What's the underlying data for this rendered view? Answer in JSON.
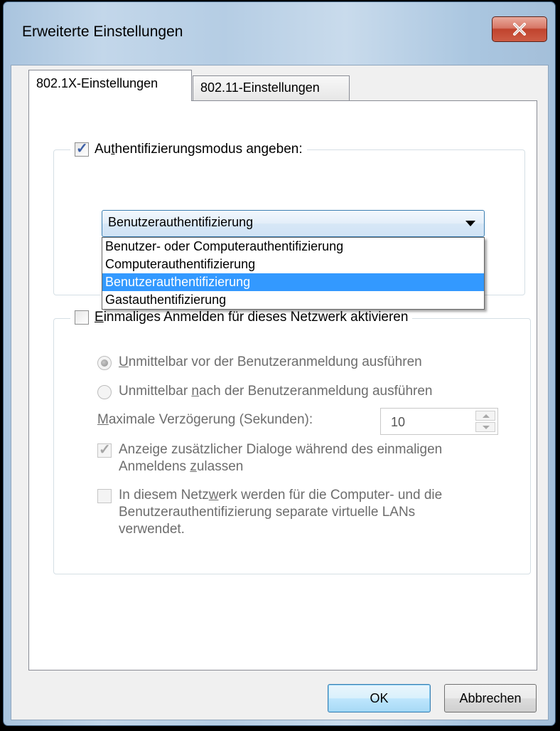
{
  "window": {
    "title": "Erweiterte Einstellungen",
    "close_label": "x"
  },
  "tabs": [
    {
      "label": "802.1X-Einstellungen",
      "active": true
    },
    {
      "label": "802.11-Einstellungen",
      "active": false
    }
  ],
  "auth_group": {
    "checkbox_checked": true,
    "label_pre": "Au",
    "label_u": "t",
    "label_post": "hentifizierungsmodus angeben:",
    "combo_value": "Benutzerauthentifizierung",
    "options": [
      "Benutzer- oder Computerauthentifizierung",
      "Computerauthentifizierung",
      "Benutzerauthentifizierung",
      "Gastauthentifizierung"
    ],
    "selected_index": 2
  },
  "sso_group": {
    "checkbox_checked": false,
    "label_u": "E",
    "label_post": "inmaliges Anmelden für dieses Netzwerk aktivieren",
    "radio_before_u": "U",
    "radio_before_post": "nmittelbar vor der Benutzeranmeldung ausführen",
    "radio_after_pre": "Unmittelbar ",
    "radio_after_u": "n",
    "radio_after_post": "ach der Benutzeranmeldung ausführen",
    "delay_u": "M",
    "delay_post": "aximale Verzögerung (Sekunden):",
    "delay_value": "10",
    "dialogs_line1": "Anzeige zusätzlicher Dialoge während des einmaligen",
    "dialogs_line2_pre": "Anmeldens ",
    "dialogs_line2_u": "z",
    "dialogs_line2_post": "ulassen",
    "vlan_line1_pre": "In diesem Netz",
    "vlan_line1_u": "w",
    "vlan_line1_post": "erk werden für die Computer- und die",
    "vlan_line2": "Benutzerauthentifizierung separate virtuelle LANs",
    "vlan_line3": "verwendet."
  },
  "buttons": {
    "ok": "OK",
    "cancel": "Abbrechen"
  }
}
